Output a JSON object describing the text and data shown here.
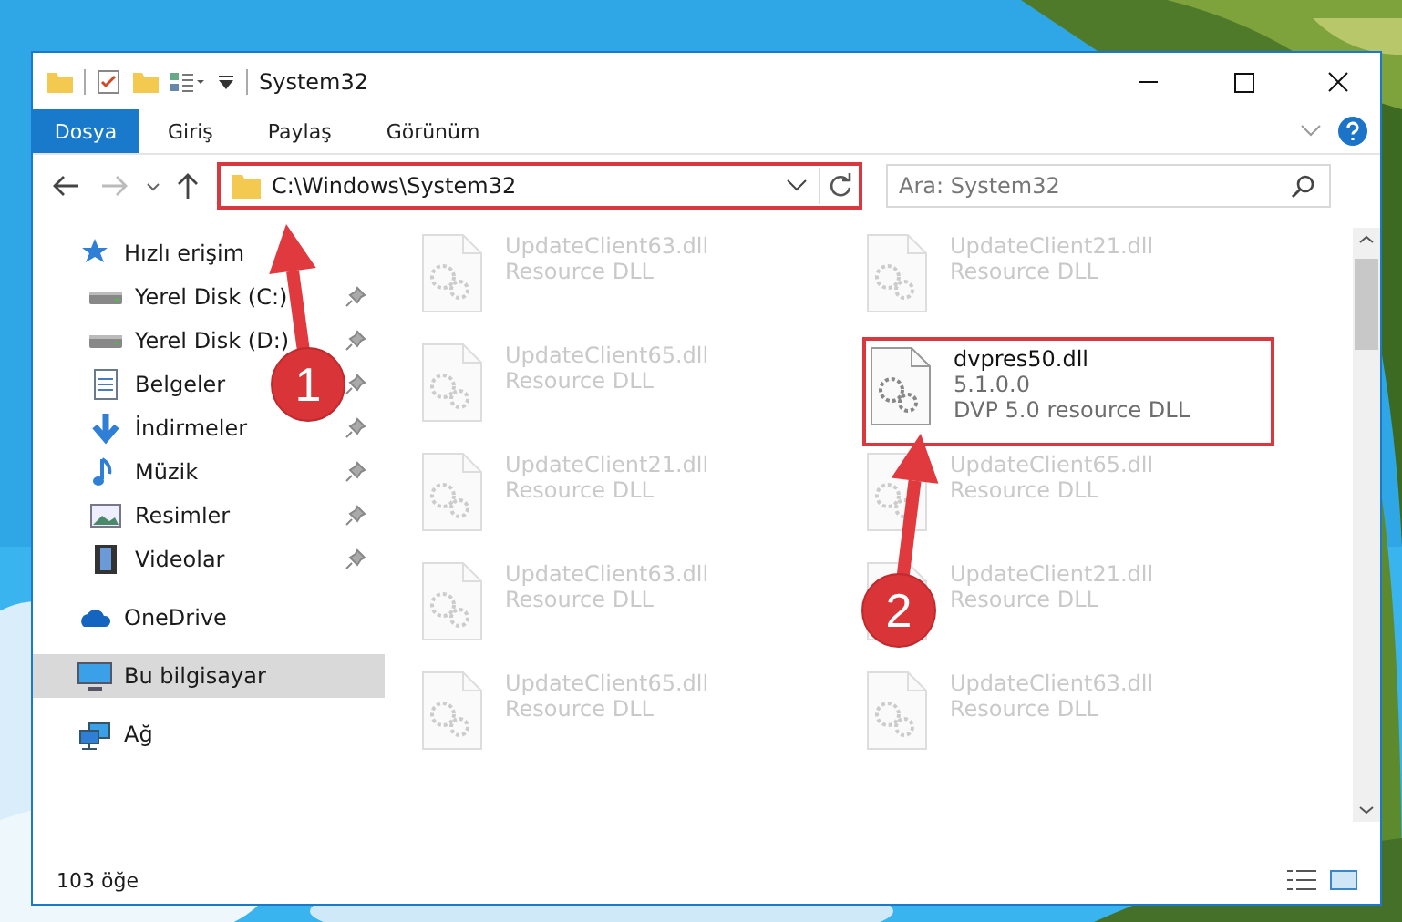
{
  "window": {
    "title": "System32"
  },
  "ribbon_tabs": [
    {
      "label": "Dosya",
      "kind": "file",
      "selected": false
    },
    {
      "label": "Giriş",
      "kind": "tab",
      "selected": false
    },
    {
      "label": "Paylaş",
      "kind": "tab",
      "selected": false
    },
    {
      "label": "Görünüm",
      "kind": "tab",
      "selected": false
    }
  ],
  "address": {
    "path": "C:\\Windows\\System32",
    "highlighted": true
  },
  "search": {
    "placeholder": "Ara: System32"
  },
  "sidebar": {
    "items": [
      {
        "label": "Hızlı erişim",
        "kind": "star",
        "selected": false,
        "children": [
          {
            "label": "Yerel Disk (C:)",
            "kind": "drive",
            "pinned": true,
            "selected": false
          },
          {
            "label": "Yerel Disk (D:)",
            "kind": "drive",
            "pinned": true,
            "selected": false
          },
          {
            "label": "Belgeler",
            "kind": "documents",
            "pinned": true,
            "selected": false
          },
          {
            "label": "İndirmeler",
            "kind": "download",
            "pinned": true,
            "selected": false
          },
          {
            "label": "Müzik",
            "kind": "music",
            "pinned": true,
            "selected": false
          },
          {
            "label": "Resimler",
            "kind": "pictures",
            "pinned": true,
            "selected": false
          },
          {
            "label": "Videolar",
            "kind": "videos",
            "pinned": true,
            "selected": false
          }
        ]
      },
      {
        "label": "OneDrive",
        "kind": "cloud",
        "selected": false
      },
      {
        "label": "Bu bilgisayar",
        "kind": "computer",
        "selected": true
      },
      {
        "label": "Ağ",
        "kind": "network",
        "selected": false
      }
    ]
  },
  "files": [
    {
      "name": "UpdateClient63.dll",
      "details": [
        "Resource DLL"
      ],
      "blurred": true,
      "highlighted": false
    },
    {
      "name": "UpdateClient21.dll",
      "details": [
        "Resource DLL"
      ],
      "blurred": true,
      "highlighted": false
    },
    {
      "name": "UpdateClient65.dll",
      "details": [
        "Resource DLL"
      ],
      "blurred": true,
      "highlighted": false
    },
    {
      "name": "dvpres50.dll",
      "details": [
        "5.1.0.0",
        "DVP 5.0 resource DLL"
      ],
      "blurred": false,
      "highlighted": true
    },
    {
      "name": "UpdateClient21.dll",
      "details": [
        "Resource DLL"
      ],
      "blurred": true,
      "highlighted": false
    },
    {
      "name": "UpdateClient65.dll",
      "details": [
        "Resource DLL"
      ],
      "blurred": true,
      "highlighted": false
    },
    {
      "name": "UpdateClient63.dll",
      "details": [
        "Resource DLL"
      ],
      "blurred": true,
      "highlighted": false
    },
    {
      "name": "UpdateClient21.dll",
      "details": [
        "Resource DLL"
      ],
      "blurred": true,
      "highlighted": false
    },
    {
      "name": "UpdateClient65.dll",
      "details": [
        "Resource DLL"
      ],
      "blurred": true,
      "highlighted": false
    },
    {
      "name": "UpdateClient63.dll",
      "details": [
        "Resource DLL"
      ],
      "blurred": true,
      "highlighted": false
    }
  ],
  "status_bar": {
    "item_count": "103 öğe"
  },
  "annotations": [
    {
      "number": "1"
    },
    {
      "number": "2"
    }
  ]
}
